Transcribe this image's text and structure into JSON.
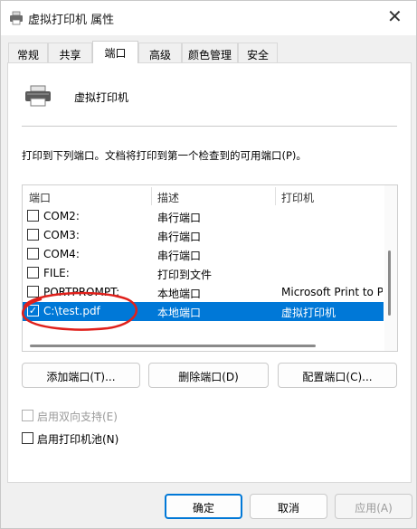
{
  "window": {
    "title": "虚拟打印机 属性",
    "close_glyph": "✕"
  },
  "tabs": [
    {
      "label": "常规"
    },
    {
      "label": "共享"
    },
    {
      "label": "端口"
    },
    {
      "label": "高级"
    },
    {
      "label": "颜色管理"
    },
    {
      "label": "安全"
    }
  ],
  "active_tab": "端口",
  "printer": {
    "name": "虚拟打印机",
    "icon": "printer-icon"
  },
  "ports": {
    "description": "打印到下列端口。文档将打印到第一个检查到的可用端口(P)。",
    "columns": [
      "端口",
      "描述",
      "打印机"
    ],
    "rows": [
      {
        "port": "COM2:",
        "desc": "串行端口",
        "printer": "",
        "checked": false,
        "selected": false
      },
      {
        "port": "COM3:",
        "desc": "串行端口",
        "printer": "",
        "checked": false,
        "selected": false
      },
      {
        "port": "COM4:",
        "desc": "串行端口",
        "printer": "",
        "checked": false,
        "selected": false
      },
      {
        "port": "FILE:",
        "desc": "打印到文件",
        "printer": "",
        "checked": false,
        "selected": false
      },
      {
        "port": "PORTPROMPT:",
        "desc": "本地端口",
        "printer": "Microsoft Print to P",
        "checked": false,
        "selected": false
      },
      {
        "port": "C:\\test.pdf",
        "desc": "本地端口",
        "printer": "虚拟打印机",
        "checked": true,
        "selected": true
      }
    ]
  },
  "port_buttons": {
    "add": "添加端口(T)...",
    "delete": "删除端口(D)",
    "configure": "配置端口(C)..."
  },
  "options": {
    "bidirectional": {
      "label": "启用双向支持(E)",
      "enabled": false,
      "checked": false
    },
    "pooling": {
      "label": "启用打印机池(N)",
      "enabled": true,
      "checked": false
    }
  },
  "footer": {
    "ok": "确定",
    "cancel": "取消",
    "apply": "应用(A)"
  },
  "colors": {
    "accent": "#0078d7",
    "annotation": "#e0201b"
  }
}
